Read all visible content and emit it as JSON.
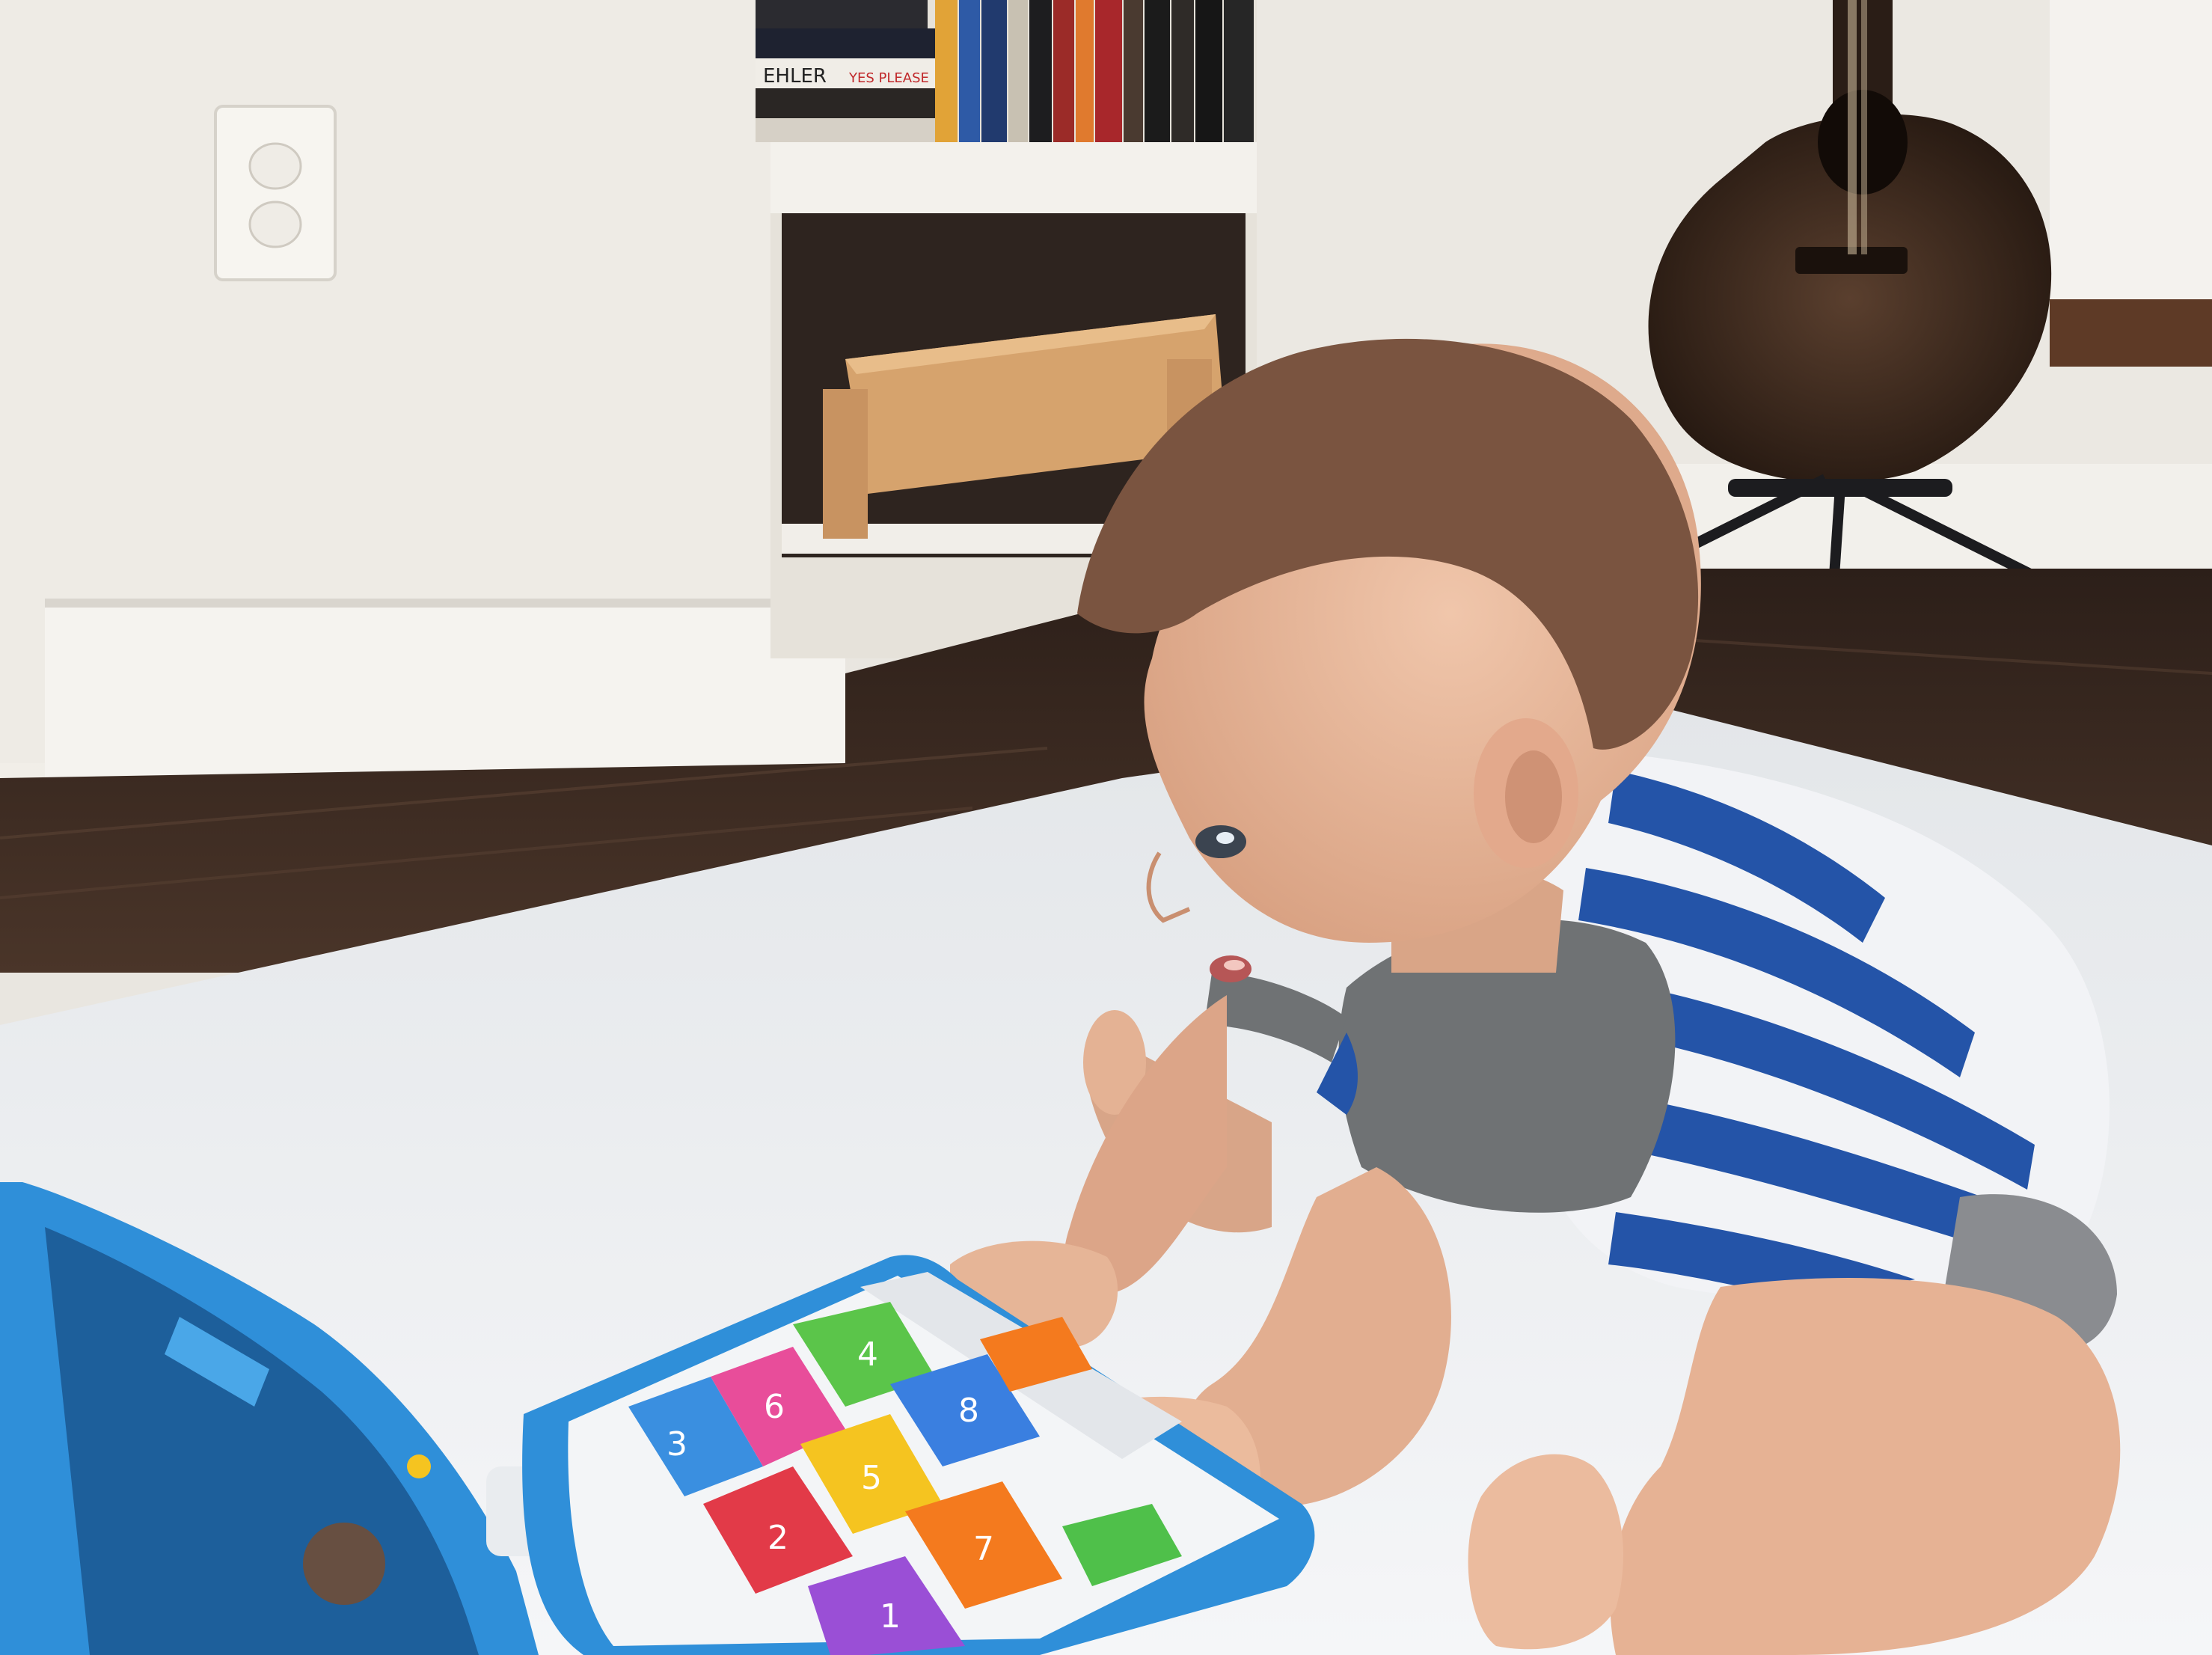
{
  "photo": {
    "subject": "baby-playing-with-toy-laptop",
    "colors": {
      "wall": "#ece9e3",
      "floor": "#3a2a22",
      "mat": "#eef0f2",
      "skin": "#e8b99c",
      "hair": "#6b4a38",
      "shirt_blue": "#2454a8",
      "shirt_white": "#f2f3f6",
      "sleeve_gray": "#6f7274",
      "guitar": "#3b2a20",
      "toy_blue": "#2f8fd9"
    }
  },
  "bookshelf": {
    "spine_text_1": "EHLER",
    "spine_text_2": "YES PLEASE"
  },
  "toy_laptop": {
    "keys": [
      {
        "name": "key-blue-3",
        "color": "#3a8fe0",
        "glyph": "3"
      },
      {
        "name": "key-pink-6",
        "color": "#e84d9a",
        "glyph": "6"
      },
      {
        "name": "key-green-house",
        "color": "#5bc54a",
        "glyph": "4"
      },
      {
        "name": "key-blue-8",
        "color": "#3a7fe0",
        "glyph": "8"
      },
      {
        "name": "key-yellow-star",
        "color": "#f5c420",
        "glyph": "5"
      },
      {
        "name": "key-red-heart",
        "color": "#e23a48",
        "glyph": "2"
      },
      {
        "name": "key-orange-square",
        "color": "#f47a1e",
        "glyph": "7"
      },
      {
        "name": "key-purple-1",
        "color": "#9a4fd6",
        "glyph": "1"
      },
      {
        "name": "key-green-side",
        "color": "#4fc04a",
        "glyph": ""
      },
      {
        "name": "key-orange-side",
        "color": "#f47a1e",
        "glyph": ""
      }
    ]
  }
}
